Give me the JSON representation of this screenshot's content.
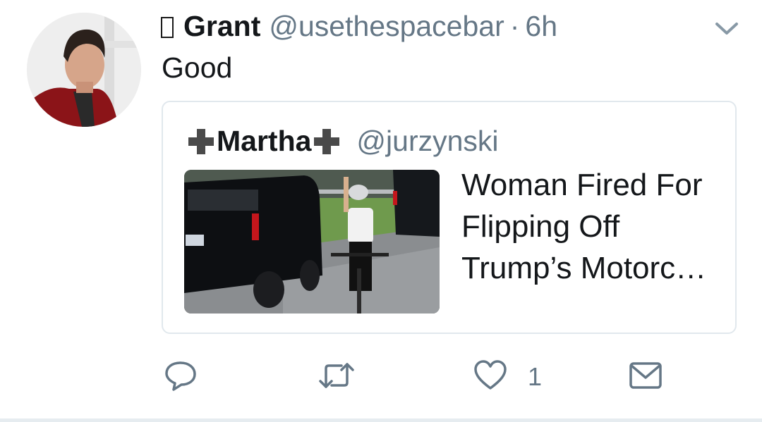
{
  "tweet": {
    "name_prefix_glyph": "box-glyph",
    "display_name": "Grant",
    "handle": "@usethespacebar",
    "separator": "·",
    "time": "6h",
    "text": "Good",
    "menu_icon": "chevron-down-icon"
  },
  "quoted": {
    "display_name": "Martha",
    "name_decoration_icon": "heavy-plus-icon",
    "handle": "@jurzynski",
    "headline_lines": [
      "Woman Fired For",
      "Flipping Off",
      "Trump’s Motorc…"
    ],
    "thumbnail": "cyclist-motorcade-photo"
  },
  "actions": {
    "reply_icon": "reply-icon",
    "retweet_icon": "retweet-icon",
    "like_icon": "heart-icon",
    "like_count": "1",
    "dm_icon": "envelope-icon"
  },
  "colors": {
    "text": "#14171a",
    "secondary": "#657786",
    "border": "#e1e8ed",
    "icon": "#657786"
  }
}
